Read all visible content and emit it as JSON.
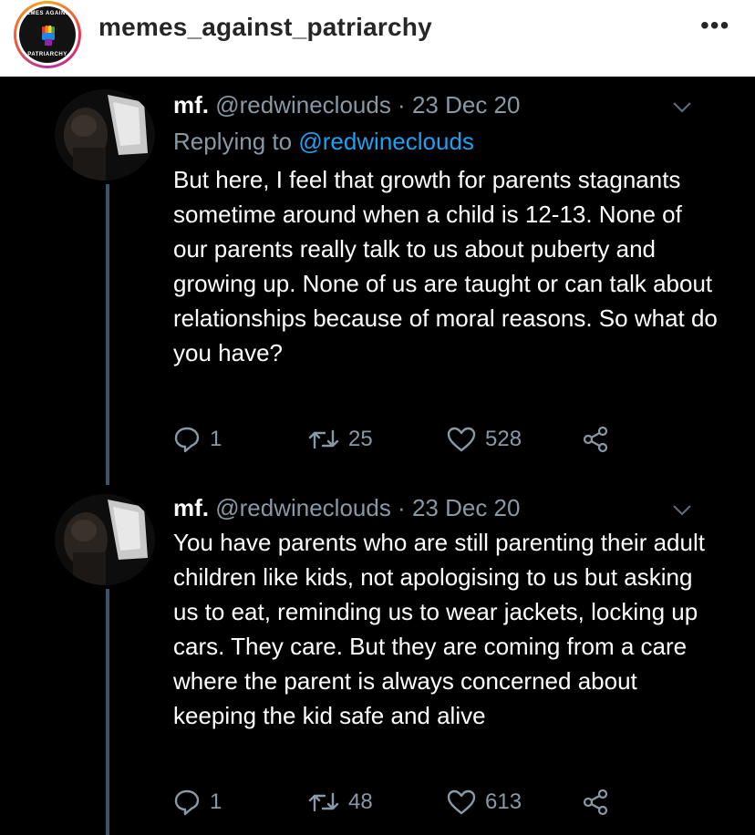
{
  "header": {
    "username": "memes_against_patriarchy",
    "avatar_text_top": "MEMES AGAINST",
    "avatar_text_bottom": "PATRIARCHY",
    "more_label": "•••"
  },
  "tweets": [
    {
      "name": "mf.",
      "meta": "@redwineclouds · 23 Dec 20",
      "replying_prefix": "Replying to",
      "replying_handle": "@redwineclouds",
      "body": "But here, I feel that growth for parents stagnants sometime around when a child is 12-13. None of our parents really talk to us about puberty and growing up. None of us are taught or can talk about relationships because of moral reasons. So what do you have?",
      "replies": "1",
      "retweets": "25",
      "likes": "528"
    },
    {
      "name": "mf.",
      "meta": "@redwineclouds · 23 Dec 20",
      "body": "You have parents who are still parenting their adult children like kids, not apologising to us but asking us to eat, reminding us to wear jackets, locking up cars. They care. But they are coming from a care where the parent is always concerned about keeping the kid safe and alive",
      "replies": "1",
      "retweets": "48",
      "likes": "613"
    }
  ],
  "colors": {
    "background": "#000000",
    "muted_text": "#8899a6",
    "link": "#1da1f2",
    "header_text": "#262626"
  }
}
